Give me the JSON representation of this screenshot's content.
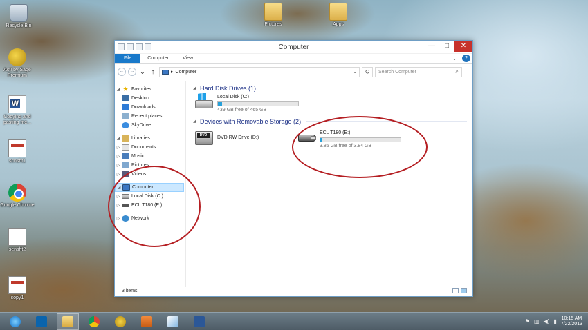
{
  "desktop": {
    "icons": [
      {
        "label": "Recycle Bin"
      },
      {
        "label": "Act! by Sage Premium"
      },
      {
        "label": "Copying and pasting me..."
      },
      {
        "label": "scnsht1"
      },
      {
        "label": "Google Chrome"
      },
      {
        "label": "sensht2"
      },
      {
        "label": "copy1"
      },
      {
        "label": "Pictures"
      },
      {
        "label": "Apps"
      }
    ]
  },
  "window": {
    "title": "Computer",
    "qat_icons": [
      "properties-icon",
      "new-folder-icon",
      "undo-icon",
      "redo-icon"
    ],
    "controls": {
      "minimize": "—",
      "maximize": "□",
      "close": "✕"
    },
    "ribbon_tabs": [
      "File",
      "Computer",
      "View"
    ],
    "ribbon_expand": "⌄",
    "help": "?",
    "nav": {
      "back": "←",
      "forward": "→",
      "up": "↑",
      "dropdown": "⌄"
    },
    "address": {
      "sep": "▸",
      "path": "Computer",
      "dropdown": "⌄"
    },
    "refresh": "↻",
    "search": {
      "placeholder": "Search Computer",
      "icon": "⌕"
    }
  },
  "nav_pane": {
    "arrows": {
      "expanded": "◢",
      "collapsed": "▷"
    },
    "favorites": {
      "label": "Favorites",
      "items": [
        "Desktop",
        "Downloads",
        "Recent places",
        "SkyDrive"
      ]
    },
    "libraries": {
      "label": "Libraries",
      "items": [
        "Documents",
        "Music",
        "Pictures",
        "Videos"
      ]
    },
    "computer": {
      "label": "Computer",
      "items": [
        "Local Disk (C:)",
        "ECL T180 (E:)"
      ]
    },
    "network": {
      "label": "Network"
    }
  },
  "content": {
    "groups": [
      {
        "header": "Hard Disk Drives (1)"
      },
      {
        "header": "Devices with Removable Storage (2)"
      }
    ],
    "drives": [
      {
        "name": "Local Disk (C:)",
        "space": "439 GB free of 465 GB",
        "used_fraction": 0.056,
        "icon": "hard-disk-icon"
      },
      {
        "name": "DVD RW Drive (D:)",
        "icon": "dvd-drive-icon",
        "badge": "DVD"
      },
      {
        "name": "ECL T180 (E:)",
        "space": "3.85 GB free of 3.84 GB",
        "used_fraction": 0.03,
        "icon": "usb-drive-icon"
      }
    ]
  },
  "status": {
    "items": "3 items"
  },
  "taskbar": {
    "apps": [
      "ie-icon",
      "outlook-icon",
      "file-explorer-icon",
      "chrome-icon",
      "act-sage-icon",
      "media-player-icon",
      "paint-icon",
      "word-icon"
    ],
    "tray_icons": {
      "flag": "⚑",
      "network": "▥",
      "volume": "◀)",
      "power": "▮"
    },
    "time": "10:15 AM",
    "date": "7/22/2013"
  },
  "colors": {
    "accent": "#1979ca",
    "annotation": "#b51f23",
    "bar_fill": "#26a0da"
  }
}
